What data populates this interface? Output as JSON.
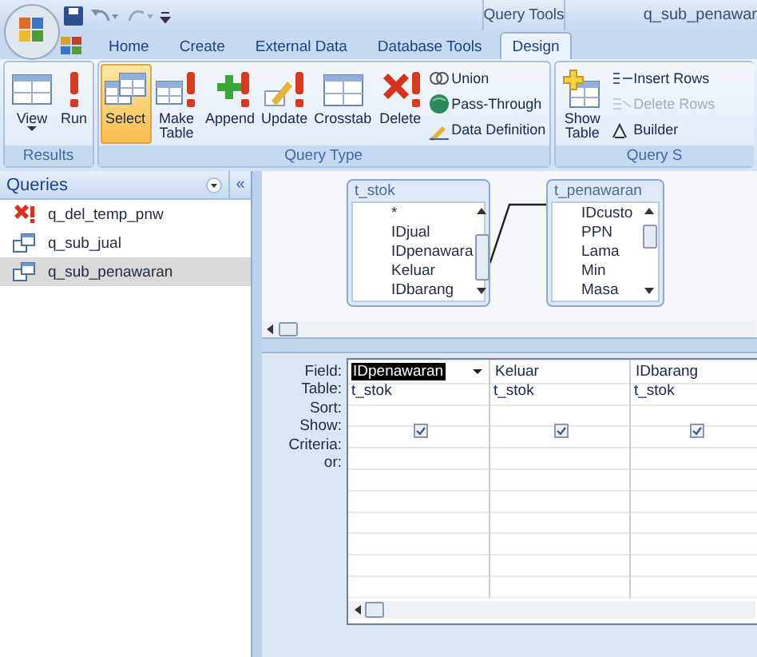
{
  "title_bar": {
    "context_tab": "Query Tools",
    "title": "q_sub_penawar"
  },
  "tabs": [
    {
      "label": "Home",
      "selected": false
    },
    {
      "label": "Create",
      "selected": false
    },
    {
      "label": "External Data",
      "selected": false
    },
    {
      "label": "Database Tools",
      "selected": false
    },
    {
      "label": "Design",
      "selected": true
    }
  ],
  "ribbon": {
    "groups": [
      {
        "label": "Results",
        "buttons": [
          {
            "label": "View",
            "kind": "large",
            "dropdown": true,
            "selected": false
          },
          {
            "label": "Run",
            "kind": "large",
            "dropdown": false,
            "selected": false
          }
        ]
      },
      {
        "label": "Query Type",
        "buttons": [
          {
            "label": "Select",
            "kind": "large",
            "dropdown": false,
            "selected": true
          },
          {
            "label": "Make Table",
            "kind": "large",
            "dropdown": false,
            "selected": false
          },
          {
            "label": "Append",
            "kind": "large",
            "dropdown": false,
            "selected": false
          },
          {
            "label": "Update",
            "kind": "large",
            "dropdown": false,
            "selected": false
          },
          {
            "label": "Crosstab",
            "kind": "large",
            "dropdown": false,
            "selected": false
          },
          {
            "label": "Delete",
            "kind": "large",
            "dropdown": false,
            "selected": false
          },
          {
            "label": "Union",
            "kind": "small",
            "disabled": false
          },
          {
            "label": "Pass-Through",
            "kind": "small",
            "disabled": false
          },
          {
            "label": "Data Definition",
            "kind": "small",
            "disabled": false
          }
        ]
      },
      {
        "label": "Query S",
        "buttons": [
          {
            "label": "Show Table",
            "kind": "large",
            "dropdown": false,
            "selected": false
          },
          {
            "label": "Insert Rows",
            "kind": "small",
            "disabled": false
          },
          {
            "label": "Delete Rows",
            "kind": "small",
            "disabled": true
          },
          {
            "label": "Builder",
            "kind": "small",
            "disabled": false
          }
        ]
      }
    ]
  },
  "navigation_pane": {
    "header": "Queries",
    "collapse": "«",
    "items": [
      {
        "label": "q_del_temp_pnw",
        "kind": "delete",
        "selected": false
      },
      {
        "label": "q_sub_jual",
        "kind": "select",
        "selected": false
      },
      {
        "label": "q_sub_penawaran",
        "kind": "select",
        "selected": true
      }
    ]
  },
  "tables": [
    {
      "title": "t_stok",
      "fields": [
        "*",
        "IDjual",
        "IDpenawara",
        "Keluar",
        "IDbarang"
      ]
    },
    {
      "title": "t_penawaran",
      "fields": [
        "IDcusto",
        "PPN",
        "Lama",
        "Min",
        "Masa"
      ]
    }
  ],
  "design_grid": {
    "row_labels": [
      "Field:",
      "Table:",
      "Sort:",
      "Show:",
      "Criteria:",
      "or:"
    ],
    "columns": [
      {
        "field": "IDpenawaran",
        "table": "t_stok",
        "show": true,
        "selected": true
      },
      {
        "field": "Keluar",
        "table": "t_stok",
        "show": true,
        "selected": false
      },
      {
        "field": "IDbarang",
        "table": "t_stok",
        "show": true,
        "selected": false
      }
    ]
  }
}
